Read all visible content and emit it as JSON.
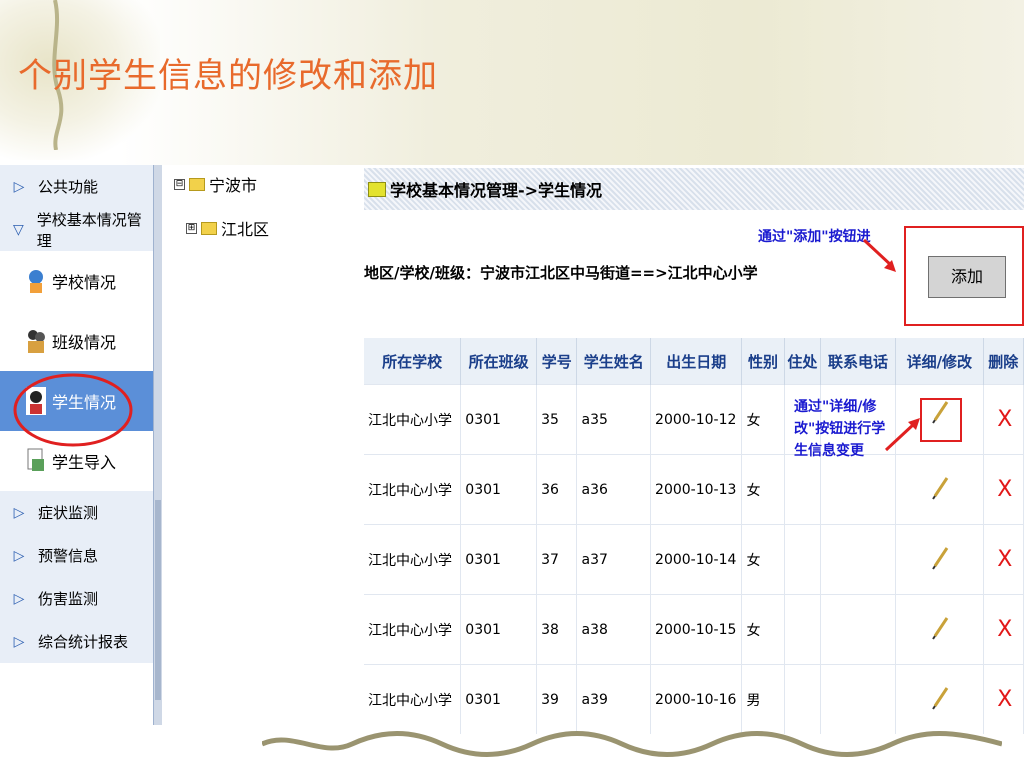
{
  "slide": {
    "title": "个别学生信息的修改和添加"
  },
  "sidebar": {
    "groups_top": [
      {
        "label": "公共功能",
        "state": "collapsed"
      },
      {
        "label": "学校基本情况管理",
        "state": "expanded"
      }
    ],
    "sub_items": [
      {
        "label": "学校情况",
        "icon": "school-icon"
      },
      {
        "label": "班级情况",
        "icon": "class-icon"
      },
      {
        "label": "学生情况",
        "icon": "student-icon",
        "active": true
      },
      {
        "label": "学生导入",
        "icon": "import-icon"
      }
    ],
    "groups_bottom": [
      {
        "label": "症状监测"
      },
      {
        "label": "预警信息"
      },
      {
        "label": "伤害监测"
      },
      {
        "label": "综合统计报表"
      }
    ]
  },
  "tree": {
    "root": {
      "label": "宁波市",
      "toggle": "⊟"
    },
    "child": {
      "label": "江北区",
      "toggle": "⊞"
    }
  },
  "main": {
    "header_title": "学校基本情况管理->学生情况",
    "path_text": "地区/学校/班级：宁波市江北区中马街道==>江北中心小学",
    "add_button": "添加",
    "note_add": "通过\"添加\"按钮进",
    "note_edit": "通过\"详细/修改\"按钮进行学生信息变更",
    "columns": [
      "所在学校",
      "所在班级",
      "学号",
      "学生姓名",
      "出生日期",
      "性别",
      "住处",
      "联系电话",
      "详细/修改",
      "删除"
    ],
    "rows": [
      [
        "江北中心小学",
        "0301",
        "35",
        "a35",
        "2000-10-12",
        "女"
      ],
      [
        "江北中心小学",
        "0301",
        "36",
        "a36",
        "2000-10-13",
        "女"
      ],
      [
        "江北中心小学",
        "0301",
        "37",
        "a37",
        "2000-10-14",
        "女"
      ],
      [
        "江北中心小学",
        "0301",
        "38",
        "a38",
        "2000-10-15",
        "女"
      ],
      [
        "江北中心小学",
        "0301",
        "39",
        "a39",
        "2000-10-16",
        "男"
      ]
    ],
    "row_actions": {
      "edit_icon": "pencil-icon",
      "delete_label": "X"
    }
  },
  "colors": {
    "title": "#e86a2c",
    "active_menu": "#5b8fd8",
    "annotation_red": "#e02020",
    "note_blue": "#1a1ad0"
  }
}
